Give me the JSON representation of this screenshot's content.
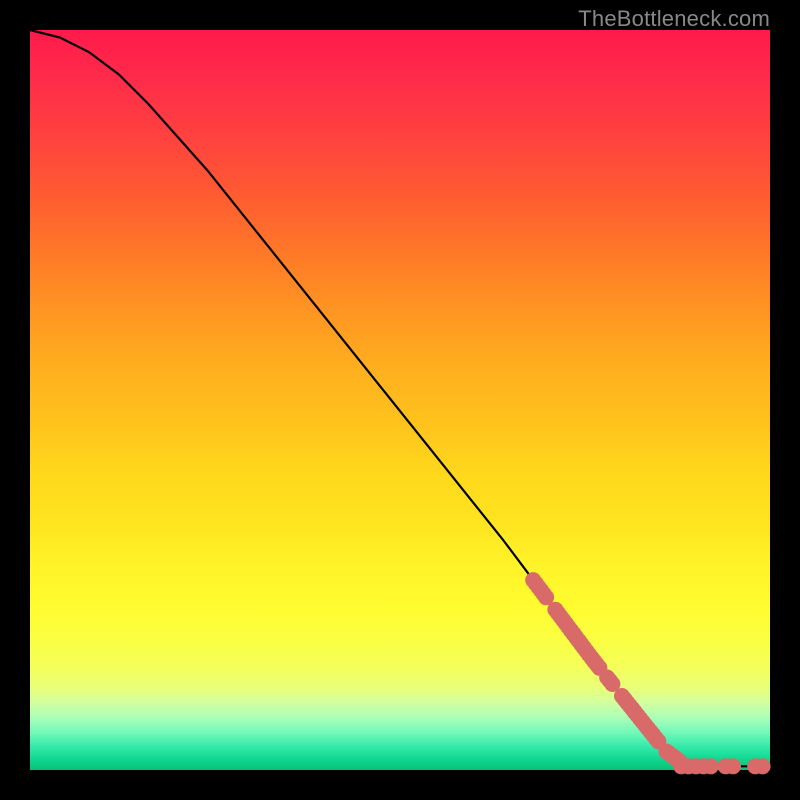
{
  "watermark": "TheBottleneck.com",
  "chart_data": {
    "type": "line",
    "title": "",
    "xlabel": "",
    "ylabel": "",
    "xlim": [
      0,
      100
    ],
    "ylim": [
      0,
      100
    ],
    "curve": {
      "name": "bottleneck-curve",
      "points": [
        {
          "x": 0,
          "y": 100
        },
        {
          "x": 4,
          "y": 99
        },
        {
          "x": 8,
          "y": 97
        },
        {
          "x": 12,
          "y": 94
        },
        {
          "x": 16,
          "y": 90
        },
        {
          "x": 24,
          "y": 81
        },
        {
          "x": 32,
          "y": 71
        },
        {
          "x": 40,
          "y": 61
        },
        {
          "x": 48,
          "y": 51
        },
        {
          "x": 56,
          "y": 41
        },
        {
          "x": 64,
          "y": 31
        },
        {
          "x": 70,
          "y": 23
        },
        {
          "x": 76,
          "y": 15
        },
        {
          "x": 80,
          "y": 10
        },
        {
          "x": 84,
          "y": 5
        },
        {
          "x": 86,
          "y": 2.5
        },
        {
          "x": 88,
          "y": 1
        },
        {
          "x": 90,
          "y": 0.5
        },
        {
          "x": 94,
          "y": 0.5
        },
        {
          "x": 100,
          "y": 0.5
        }
      ]
    },
    "marker_segments": [
      {
        "x_start": 68,
        "x_end": 70,
        "along_curve": true
      },
      {
        "x_start": 71,
        "x_end": 77,
        "along_curve": true
      },
      {
        "x_start": 78,
        "x_end": 79,
        "along_curve": true
      },
      {
        "x_start": 80,
        "x_end": 85,
        "along_curve": true
      },
      {
        "x_start": 86,
        "x_end": 88,
        "along_curve": true
      }
    ],
    "bottom_markers_x": [
      88,
      89,
      90,
      91,
      92,
      94,
      95,
      98,
      99
    ],
    "marker_color": "#d86a6a",
    "marker_radius_px": 8
  }
}
